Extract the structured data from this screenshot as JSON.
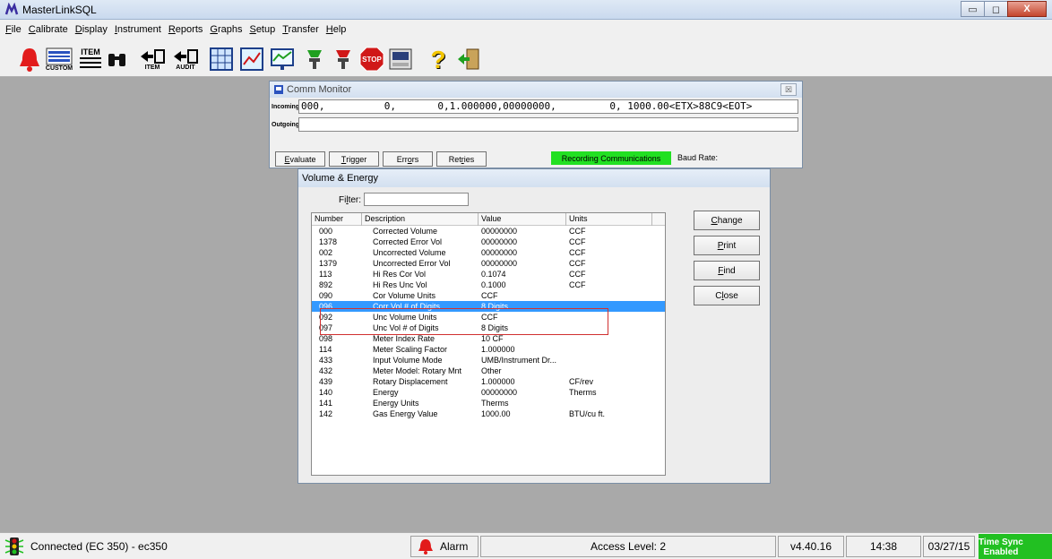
{
  "app": {
    "title": "MasterLinkSQL"
  },
  "window_buttons": {
    "minimize": "▭",
    "maximize": "◻",
    "close": "X"
  },
  "menu": [
    {
      "pre": "",
      "ul": "F",
      "post": "ile"
    },
    {
      "pre": "",
      "ul": "C",
      "post": "alibrate"
    },
    {
      "pre": "",
      "ul": "D",
      "post": "isplay"
    },
    {
      "pre": "",
      "ul": "I",
      "post": "nstrument"
    },
    {
      "pre": "",
      "ul": "R",
      "post": "eports"
    },
    {
      "pre": "",
      "ul": "G",
      "post": "raphs"
    },
    {
      "pre": "",
      "ul": "S",
      "post": "etup"
    },
    {
      "pre": "",
      "ul": "T",
      "post": "ransfer"
    },
    {
      "pre": "",
      "ul": "H",
      "post": "elp"
    }
  ],
  "toolbar": {
    "custom_label": "CUSTOM",
    "item_label": "ITEM",
    "item_label2": "ITEM",
    "audit_label": "AUDIT",
    "stop_label": "STOP",
    "help_glyph": "?"
  },
  "comm_monitor": {
    "title": "Comm Monitor",
    "close": "☒",
    "incoming_label": "Incoming",
    "incoming_value": "000,          0,       0,1.000000,00000000,         0, 1000.00<ETX>88C9<EOT>",
    "outgoing_label": "Outgoing",
    "outgoing_value": "",
    "buttons": [
      {
        "pre": "",
        "ul": "E",
        "post": "valuate"
      },
      {
        "pre": "",
        "ul": "T",
        "post": "rigger"
      },
      {
        "pre": "Err",
        "ul": "o",
        "post": "rs"
      },
      {
        "pre": "Ret",
        "ul": "r",
        "post": "ies"
      }
    ],
    "recording_status": "Recording Communications",
    "baud_rate_label": "Baud Rate:",
    "colors": {
      "recording": "#22e022"
    }
  },
  "volume_energy": {
    "title": "Volume & Energy",
    "filter_label_pre": "Fi",
    "filter_label_ul": "l",
    "filter_label_post": "ter:",
    "filter_value": "",
    "columns": [
      "Number",
      "Description",
      "Value",
      "Units"
    ],
    "rows": [
      [
        "000",
        "Corrected Volume",
        "00000000",
        "CCF"
      ],
      [
        "1378",
        "Corrected Error Vol",
        "00000000",
        "CCF"
      ],
      [
        "002",
        "Uncorrected Volume",
        "00000000",
        "CCF"
      ],
      [
        "1379",
        "Uncorrected Error Vol",
        "00000000",
        "CCF"
      ],
      [
        "113",
        "Hi Res Cor Vol",
        "0.1074",
        "CCF"
      ],
      [
        "892",
        "Hi Res Unc Vol",
        "0.1000",
        "CCF"
      ],
      [
        "090",
        "Cor Volume Units",
        "CCF",
        ""
      ],
      [
        "096",
        "Corr Vol # of Digits",
        "8 Digits",
        ""
      ],
      [
        "092",
        "Unc Volume Units",
        "CCF",
        ""
      ],
      [
        "097",
        "Unc Vol # of Digits",
        "8 Digits",
        ""
      ],
      [
        "098",
        "Meter Index Rate",
        "10 CF",
        ""
      ],
      [
        "114",
        "Meter Scaling Factor",
        "1.000000",
        ""
      ],
      [
        "433",
        "Input Volume Mode",
        "UMB/Instrument Dr...",
        ""
      ],
      [
        "432",
        "Meter Model: Rotary Mnt",
        "Other",
        ""
      ],
      [
        "439",
        "Rotary Displacement",
        "1.000000",
        "CF/rev"
      ],
      [
        "140",
        "Energy",
        "00000000",
        "Therms"
      ],
      [
        "141",
        "Energy Units",
        "Therms",
        ""
      ],
      [
        "142",
        "Gas Energy Value",
        "1000.00",
        "BTU/cu ft."
      ]
    ],
    "selected_row": 7,
    "buttons": [
      {
        "pre": "",
        "ul": "C",
        "post": "hange"
      },
      {
        "pre": "",
        "ul": "P",
        "post": "rint"
      },
      {
        "pre": "",
        "ul": "F",
        "post": "ind"
      },
      {
        "pre": "C",
        "ul": "l",
        "post": "ose"
      }
    ],
    "colors": {
      "selection": "#3399ff",
      "highlight_box": "#d03030"
    }
  },
  "statusbar": {
    "connected": "Connected (EC 350) - ec350",
    "alarm": "Alarm",
    "access_level": "Access Level: 2",
    "version": "v4.40.16",
    "time": "14:38",
    "date": "03/27/15",
    "time_sync_line1": "Time Sync",
    "time_sync_line2": "Enabled",
    "colors": {
      "time_sync": "#22c022"
    }
  }
}
